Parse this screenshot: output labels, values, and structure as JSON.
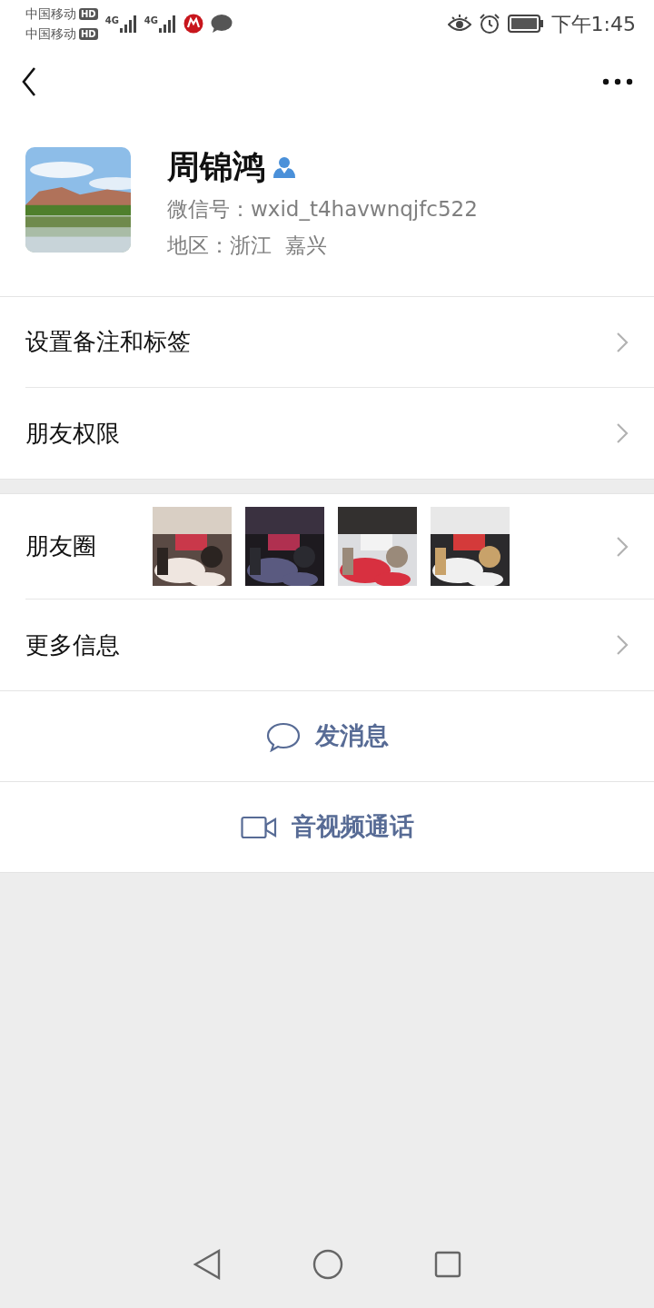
{
  "status_bar": {
    "carriers": [
      {
        "name": "中国移动",
        "badge": "HD",
        "network": "4G"
      },
      {
        "name": "中国移动",
        "badge": "HD",
        "network": "4G"
      }
    ],
    "time": "下午1:45"
  },
  "profile": {
    "name": "周锦鸿",
    "id_label": "微信号：",
    "id_value": "wxid_t4havwnqjfc522",
    "region_label": "地区：",
    "region_value": "浙江  嘉兴"
  },
  "groups": [
    {
      "items": [
        {
          "kind": "link",
          "label": "设置备注和标签"
        },
        {
          "kind": "link",
          "label": "朋友权限"
        }
      ]
    },
    {
      "items": [
        {
          "kind": "moments",
          "label": "朋友圈"
        },
        {
          "kind": "link",
          "label": "更多信息"
        }
      ]
    }
  ],
  "actions": [
    {
      "kind": "message",
      "label": "发消息"
    },
    {
      "kind": "call",
      "label": "音视频通话"
    }
  ]
}
